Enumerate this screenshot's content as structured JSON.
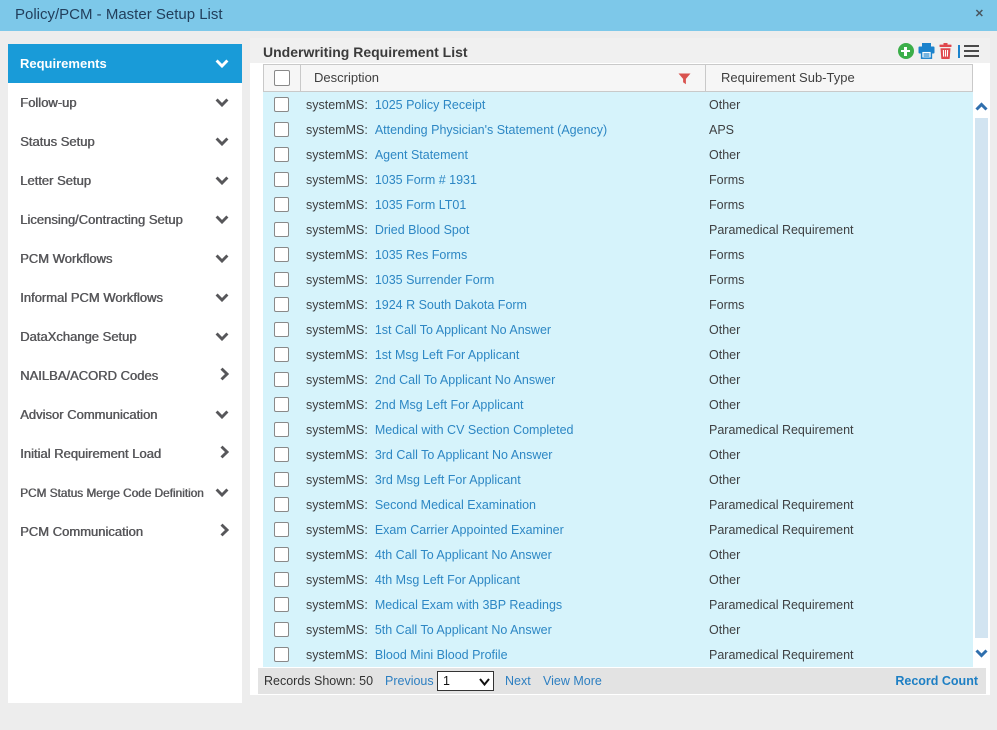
{
  "window": {
    "title": "Policy/PCM - Master Setup List",
    "close": "✕"
  },
  "sidebar": {
    "items": [
      {
        "label": "Requirements",
        "chevron": "down",
        "active": true
      },
      {
        "label": "Follow-up",
        "chevron": "down",
        "active": false
      },
      {
        "label": "Status Setup",
        "chevron": "down",
        "active": false
      },
      {
        "label": "Letter Setup",
        "chevron": "down",
        "active": false
      },
      {
        "label": "Licensing/Contracting Setup",
        "chevron": "down",
        "active": false
      },
      {
        "label": "PCM Workflows",
        "chevron": "down",
        "active": false
      },
      {
        "label": "Informal PCM Workflows",
        "chevron": "down",
        "active": false
      },
      {
        "label": "DataXchange Setup",
        "chevron": "down",
        "active": false
      },
      {
        "label": "NAILBA/ACORD Codes",
        "chevron": "right",
        "active": false
      },
      {
        "label": "Advisor Communication",
        "chevron": "down",
        "active": false
      },
      {
        "label": "Initial Requirement Load",
        "chevron": "right",
        "active": false
      },
      {
        "label": "PCM Status Merge Code Definition",
        "chevron": "down",
        "active": false
      },
      {
        "label": "PCM Communication",
        "chevron": "right",
        "active": false
      }
    ]
  },
  "main": {
    "title": "Underwriting Requirement List",
    "toolbar_icons": [
      "add",
      "print",
      "delete",
      "menu"
    ],
    "table": {
      "columns": {
        "description": "Description",
        "sub_type": "Requirement Sub-Type"
      },
      "row_prefix": "systemMS:",
      "rows": [
        {
          "description": "1025 Policy Receipt",
          "sub_type": "Other"
        },
        {
          "description": "Attending Physician's Statement (Agency)",
          "sub_type": "APS"
        },
        {
          "description": "Agent Statement",
          "sub_type": "Other"
        },
        {
          "description": "1035 Form # 1931",
          "sub_type": "Forms"
        },
        {
          "description": "1035 Form LT01",
          "sub_type": "Forms"
        },
        {
          "description": "Dried Blood Spot",
          "sub_type": "Paramedical Requirement"
        },
        {
          "description": "1035 Res Forms",
          "sub_type": "Forms"
        },
        {
          "description": "1035 Surrender Form",
          "sub_type": "Forms"
        },
        {
          "description": "1924 R South Dakota Form",
          "sub_type": "Forms"
        },
        {
          "description": "1st Call To Applicant No Answer",
          "sub_type": "Other"
        },
        {
          "description": "1st Msg Left For Applicant",
          "sub_type": "Other"
        },
        {
          "description": "2nd Call To Applicant No Answer",
          "sub_type": "Other"
        },
        {
          "description": "2nd Msg Left For Applicant",
          "sub_type": "Other"
        },
        {
          "description": "Medical with CV Section Completed",
          "sub_type": "Paramedical Requirement"
        },
        {
          "description": "3rd Call To Applicant No Answer",
          "sub_type": "Other"
        },
        {
          "description": "3rd Msg Left For Applicant",
          "sub_type": "Other"
        },
        {
          "description": "Second Medical Examination",
          "sub_type": "Paramedical Requirement"
        },
        {
          "description": "Exam Carrier Appointed Examiner",
          "sub_type": "Paramedical Requirement"
        },
        {
          "description": "4th Call To Applicant No Answer",
          "sub_type": "Other"
        },
        {
          "description": "4th Msg Left For Applicant",
          "sub_type": "Other"
        },
        {
          "description": "Medical Exam with 3BP Readings",
          "sub_type": "Paramedical Requirement"
        },
        {
          "description": "5th Call To Applicant No Answer",
          "sub_type": "Other"
        },
        {
          "description": "Blood Mini Blood Profile",
          "sub_type": "Paramedical Requirement"
        }
      ]
    },
    "footer": {
      "records_shown": "Records Shown: 50",
      "previous": "Previous",
      "page_value": "1",
      "next": "Next",
      "view_more": "View More",
      "record_count": "Record Count"
    }
  },
  "colors": {
    "titlebar_bg": "#7dc8e9",
    "sidebar_active_bg": "#199bd8",
    "row_bg": "#d6f3fb",
    "link_blue": "#2d87c4",
    "add_green": "#3bae49",
    "print_blue": "#1b82cc",
    "delete_red": "#e0484e",
    "filter_red": "#d9534f"
  }
}
